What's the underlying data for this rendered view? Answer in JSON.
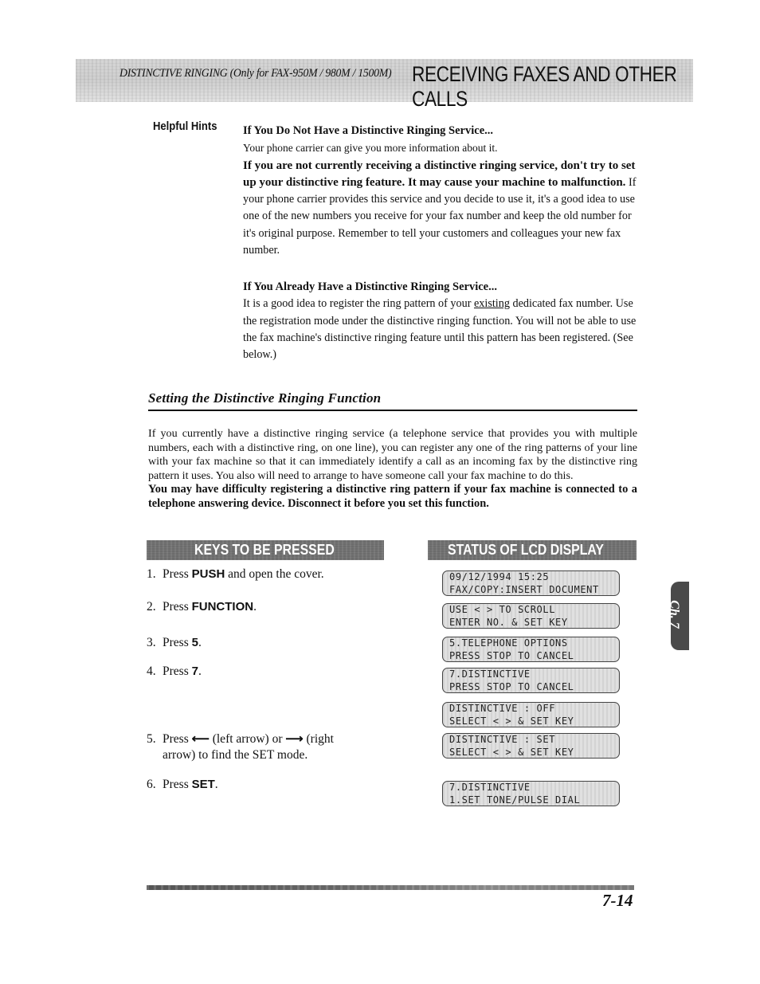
{
  "header": {
    "subtitle": "DISTINCTIVE RINGING (Only for FAX-950M / 980M / 1500M)",
    "title": "RECEIVING FAXES AND OTHER CALLS"
  },
  "hints": {
    "label": "Helpful Hints",
    "section1": {
      "heading": "If You Do Not Have a Distinctive Ringing Service...",
      "line1": "Your phone carrier can give you more information about it.",
      "bold_warning": "If you are not currently receiving a distinctive ringing service, don't try to set up your distinctive ring feature. It may cause your machine to malfunction.",
      "body": " If your phone carrier provides this service and you decide to use it, it's a good idea to use one of the new numbers you receive for your fax number and keep the old number for it's original purpose. Remember to tell your customers and colleagues your new fax number."
    },
    "section2": {
      "heading": "If You Already Have a Distinctive Ringing Service...",
      "body_before": "It is a good idea to register the ring pattern of your ",
      "underlined": "existing",
      "body_after": " dedicated fax number. Use the registration mode under the distinctive ringing function. You will not be able to use the fax machine's distinctive ringing feature until this pattern has been registered. (See below.)"
    }
  },
  "section": {
    "title": "Setting the Distinctive Ringing Function",
    "intro": "If you currently have a distinctive ringing service (a telephone service that provides you with multiple numbers, each with a distinctive ring, on one line), you can register any one of the ring patterns of your line with your fax machine so that it can immediately identify a call as an incoming fax by the distinctive ring pattern it uses. You also will need to arrange to have someone call your fax machine to do this.",
    "warning": "You may have difficulty registering a distinctive ring pattern if your fax machine is connected to a telephone answering device. Disconnect it before you set this function."
  },
  "columns": {
    "keys_header": "KEYS TO BE PRESSED",
    "status_header": "STATUS OF LCD DISPLAY"
  },
  "steps": [
    {
      "num": "1.",
      "pre": "Press ",
      "key": "PUSH",
      "post": " and open the cover."
    },
    {
      "num": "2.",
      "pre": "Press ",
      "key": "FUNCTION",
      "post": "."
    },
    {
      "num": "3.",
      "pre": "Press ",
      "key": "5",
      "post": "."
    },
    {
      "num": "4.",
      "pre": "Press ",
      "key": "7",
      "post": "."
    },
    {
      "num": "5.",
      "pre": "Press ",
      "arrow_left": "⟵",
      "mid": " (left arrow) or ",
      "arrow_right": "⟶",
      "post": " (right",
      "cont": "arrow) to find the SET mode."
    },
    {
      "num": "6.",
      "pre": "Press ",
      "key": "SET",
      "post": "."
    }
  ],
  "lcd": [
    {
      "line1": "09/12/1994 15:25",
      "line2": "FAX/COPY:INSERT DOCUMENT"
    },
    {
      "line1": "USE < > TO SCROLL",
      "line2": "ENTER NO. & SET KEY"
    },
    {
      "line1": "5.TELEPHONE OPTIONS",
      "line2": "PRESS STOP TO CANCEL"
    },
    {
      "line1": "7.DISTINCTIVE",
      "line2": "PRESS STOP TO CANCEL"
    },
    {
      "line1": "DISTINCTIVE : OFF",
      "line2": "SELECT < > & SET KEY"
    },
    {
      "line1": "DISTINCTIVE : SET",
      "line2": "SELECT < > & SET KEY"
    },
    {
      "line1": "7.DISTINCTIVE",
      "line2": "1.SET TONE/PULSE DIAL"
    }
  ],
  "chapter_tab": "Ch. 7",
  "page_number": "7-14"
}
